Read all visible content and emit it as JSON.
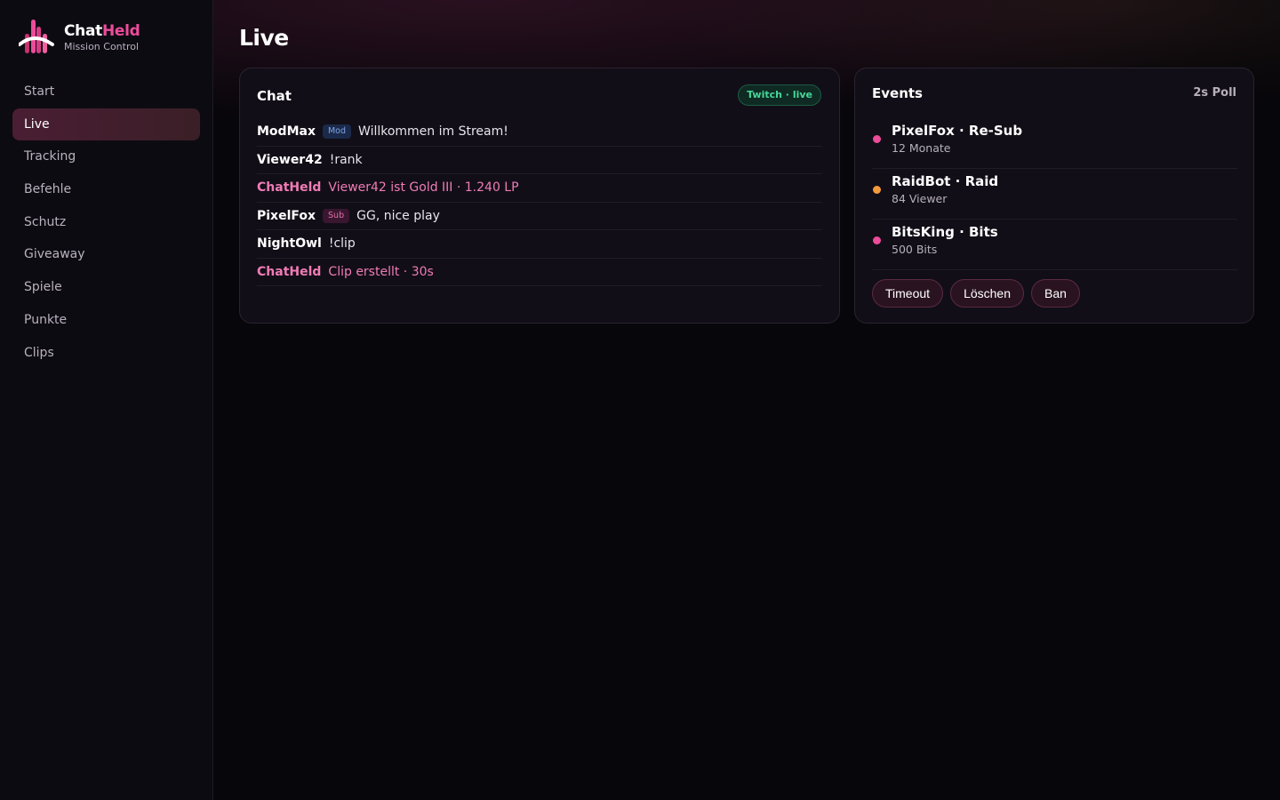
{
  "brand": {
    "name_part1": "Chat",
    "name_part2": "Held",
    "subtitle": "Mission Control"
  },
  "nav": {
    "items": [
      {
        "label": "Start"
      },
      {
        "label": "Live",
        "active": true
      },
      {
        "label": "Tracking"
      },
      {
        "label": "Befehle"
      },
      {
        "label": "Schutz"
      },
      {
        "label": "Giveaway"
      },
      {
        "label": "Spiele"
      },
      {
        "label": "Punkte"
      },
      {
        "label": "Clips"
      }
    ]
  },
  "page": {
    "title": "Live"
  },
  "chat": {
    "title": "Chat",
    "status_badge": "Twitch · live",
    "messages": [
      {
        "user": "ModMax",
        "tag": "Mod",
        "text": "Willkommen im Stream!"
      },
      {
        "user": "Viewer42",
        "text": "!rank"
      },
      {
        "user": "ChatHeld",
        "text": "Viewer42 ist Gold III · 1.240 LP",
        "bot": true
      },
      {
        "user": "PixelFox",
        "tag": "Sub",
        "text": "GG, nice play"
      },
      {
        "user": "NightOwl",
        "text": "!clip"
      },
      {
        "user": "ChatHeld",
        "text": "Clip erstellt · 30s",
        "bot": true
      }
    ]
  },
  "events": {
    "title": "Events",
    "poll_label": "2s Poll",
    "items": [
      {
        "title": "PixelFox · Re-Sub",
        "detail": "12 Monate",
        "dot_color": "#ec4c9a"
      },
      {
        "title": "RaidBot · Raid",
        "detail": "84 Viewer",
        "dot_color": "#f59a3c"
      },
      {
        "title": "BitsKing · Bits",
        "detail": "500 Bits",
        "dot_color": "#ec4c9a"
      }
    ],
    "actions": {
      "timeout": "Timeout",
      "delete": "Löschen",
      "ban": "Ban"
    }
  }
}
